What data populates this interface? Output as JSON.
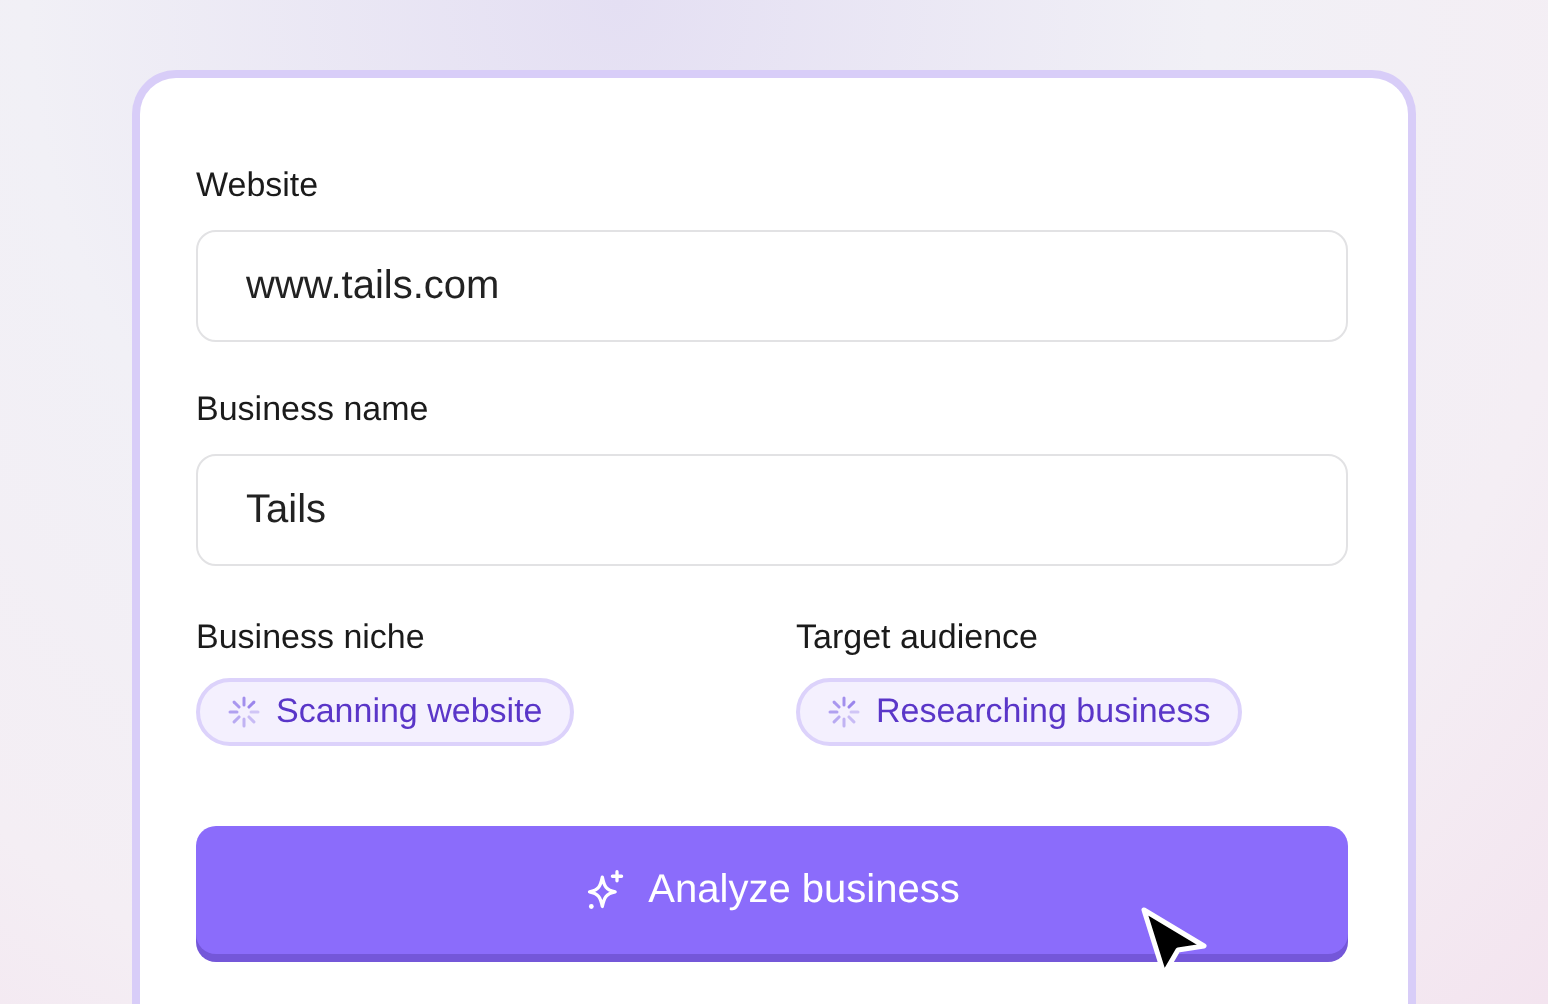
{
  "form": {
    "text_fields": [
      {
        "label": "Website",
        "value": "www.tails.com"
      },
      {
        "label": "Business name",
        "value": "Tails"
      }
    ],
    "status_fields": [
      {
        "label": "Business niche",
        "status": "Scanning website"
      },
      {
        "label": "Target audience",
        "status": "Researching business"
      }
    ],
    "submit_button": {
      "label": "Analyze business"
    }
  }
}
